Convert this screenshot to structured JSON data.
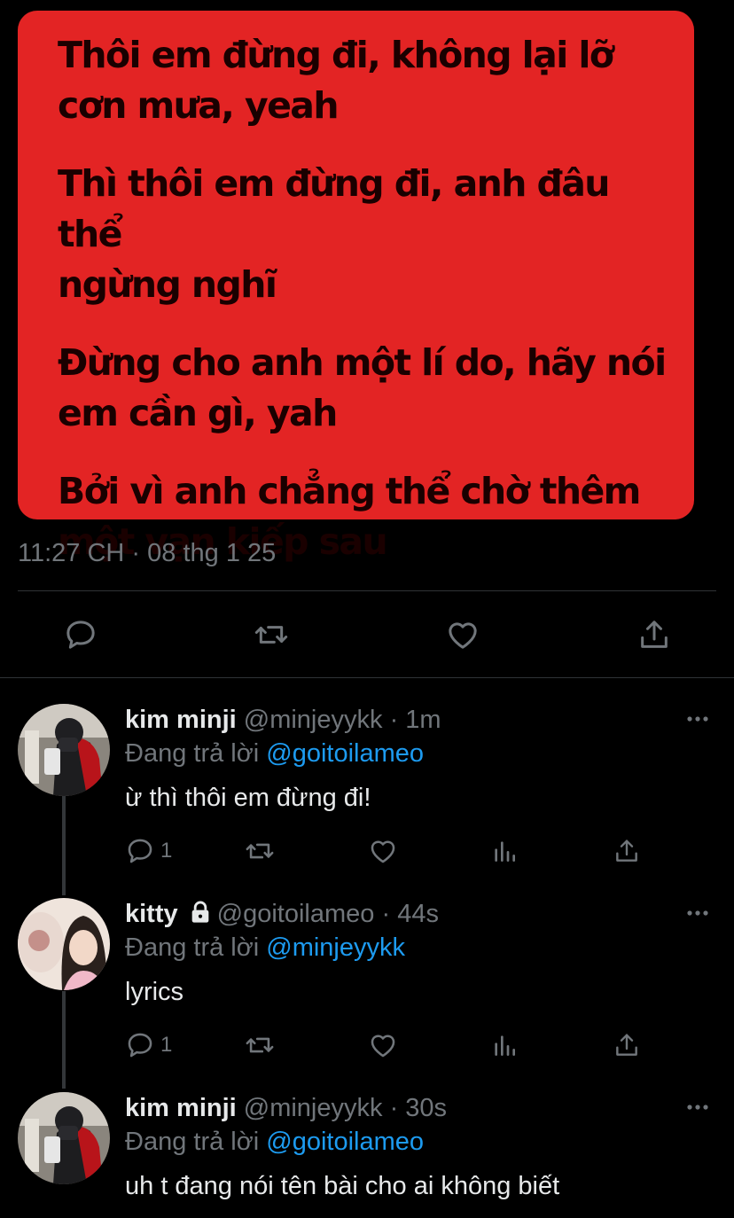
{
  "post": {
    "lyrics": [
      "Thôi em đừng đi, không lại lỡ\ncơn mưa, yeah",
      "Thì thôi em đừng đi, anh đâu thể\nngừng nghĩ",
      "Đừng cho anh một lí do, hãy nói\nem cần gì, yah",
      "Bởi vì anh chẳng thể chờ thêm\nmột vạn kiếp sau"
    ],
    "card_color": "#e32424",
    "timestamp": "11:27 CH · 08 thg 1 25",
    "actions": [
      "reply-icon",
      "retweet-icon",
      "like-icon",
      "share-icon"
    ]
  },
  "replies": [
    {
      "name": "kim minji",
      "handle": "@minjeyykk",
      "age": "1m",
      "replying_prefix": "Đang trả lời ",
      "replying_to": "@goitoilameo",
      "text": "ừ thì thôi em đừng đi!",
      "reply_count": "1",
      "locked": false
    },
    {
      "name": "kitty",
      "handle": "@goitoilameo",
      "age": "44s",
      "replying_prefix": "Đang trả lời ",
      "replying_to": "@minjeyykk",
      "text": "lyrics",
      "reply_count": "1",
      "locked": true
    },
    {
      "name": "kim minji",
      "handle": "@minjeyykk",
      "age": "30s",
      "replying_prefix": "Đang trả lời ",
      "replying_to": "@goitoilameo",
      "text": "uh t đang nói tên bài cho ai không biết",
      "reply_count": "",
      "locked": false
    }
  ],
  "separator": " · ",
  "colors": {
    "link": "#1d9bf0",
    "muted": "#71767b",
    "text": "#e7e9ea",
    "background": "#000000"
  }
}
